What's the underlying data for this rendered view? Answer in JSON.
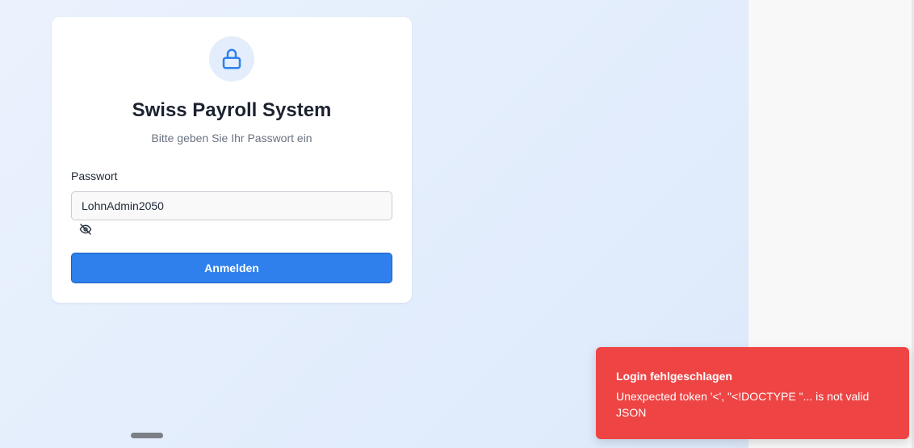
{
  "login": {
    "title": "Swiss Payroll System",
    "subtitle": "Bitte geben Sie Ihr Passwort ein",
    "password_label": "Passwort",
    "password_value": "LohnAdmin2050",
    "submit_label": "Anmelden",
    "icons": {
      "lock": "lock-icon",
      "toggle": "eye-off-icon"
    }
  },
  "toast": {
    "title": "Login fehlgeschlagen",
    "message": "Unexpected token '<', \"<!DOCTYPE \"... is not valid JSON"
  },
  "colors": {
    "primary": "#2f80ed",
    "error": "#ef4444",
    "background": "#e4eefc"
  }
}
